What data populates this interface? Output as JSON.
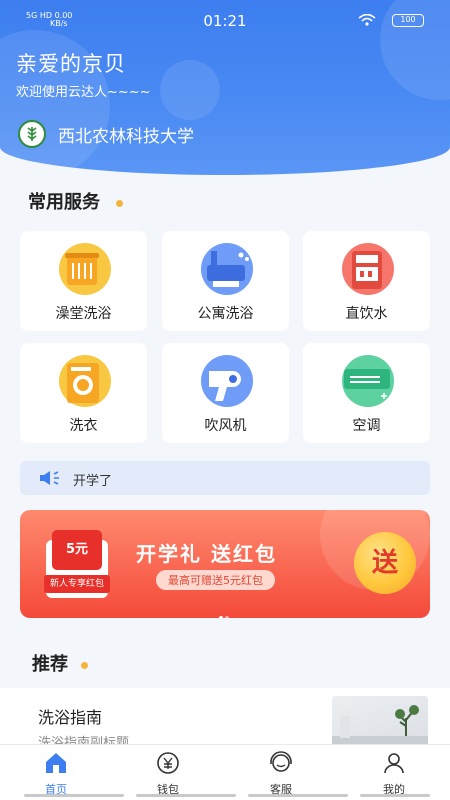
{
  "status_bar": {
    "network": "5G HD",
    "speed": "0.00",
    "speed_unit": "KB/s",
    "time": "01:21",
    "battery": "100"
  },
  "header": {
    "greeting": "亲爱的京贝",
    "welcome": "欢迎使用云达人~~~~",
    "school": "西北农林科技大学"
  },
  "services": {
    "title": "常用服务",
    "items": [
      {
        "label": "澡堂洗浴",
        "icon": "bathhouse-shower-icon"
      },
      {
        "label": "公寓洗浴",
        "icon": "apartment-shower-icon"
      },
      {
        "label": "直饮水",
        "icon": "water-dispenser-icon"
      },
      {
        "label": "洗衣",
        "icon": "washing-machine-icon"
      },
      {
        "label": "吹风机",
        "icon": "hair-dryer-icon"
      },
      {
        "label": "空调",
        "icon": "air-conditioner-icon"
      }
    ]
  },
  "notice": {
    "text": "开学了"
  },
  "banner": {
    "title": "开学礼  送红包",
    "subtitle": "最高可赠送5元红包",
    "button": "送",
    "amount": "5元",
    "tag": "新人专享红包"
  },
  "recommend": {
    "title": "推荐",
    "items": [
      {
        "title": "洗浴指南",
        "subtitle": "洗浴指南副标题"
      }
    ]
  },
  "tabbar": [
    {
      "label": "首页",
      "icon": "home-icon",
      "active": true
    },
    {
      "label": "钱包",
      "icon": "wallet-icon",
      "active": false
    },
    {
      "label": "客服",
      "icon": "customer-service-icon",
      "active": false
    },
    {
      "label": "我的",
      "icon": "profile-icon",
      "active": false
    }
  ],
  "colors": {
    "primary": "#3d7ef0",
    "accent_dot": "#f5b53b",
    "banner_red": "#f44a3a"
  }
}
